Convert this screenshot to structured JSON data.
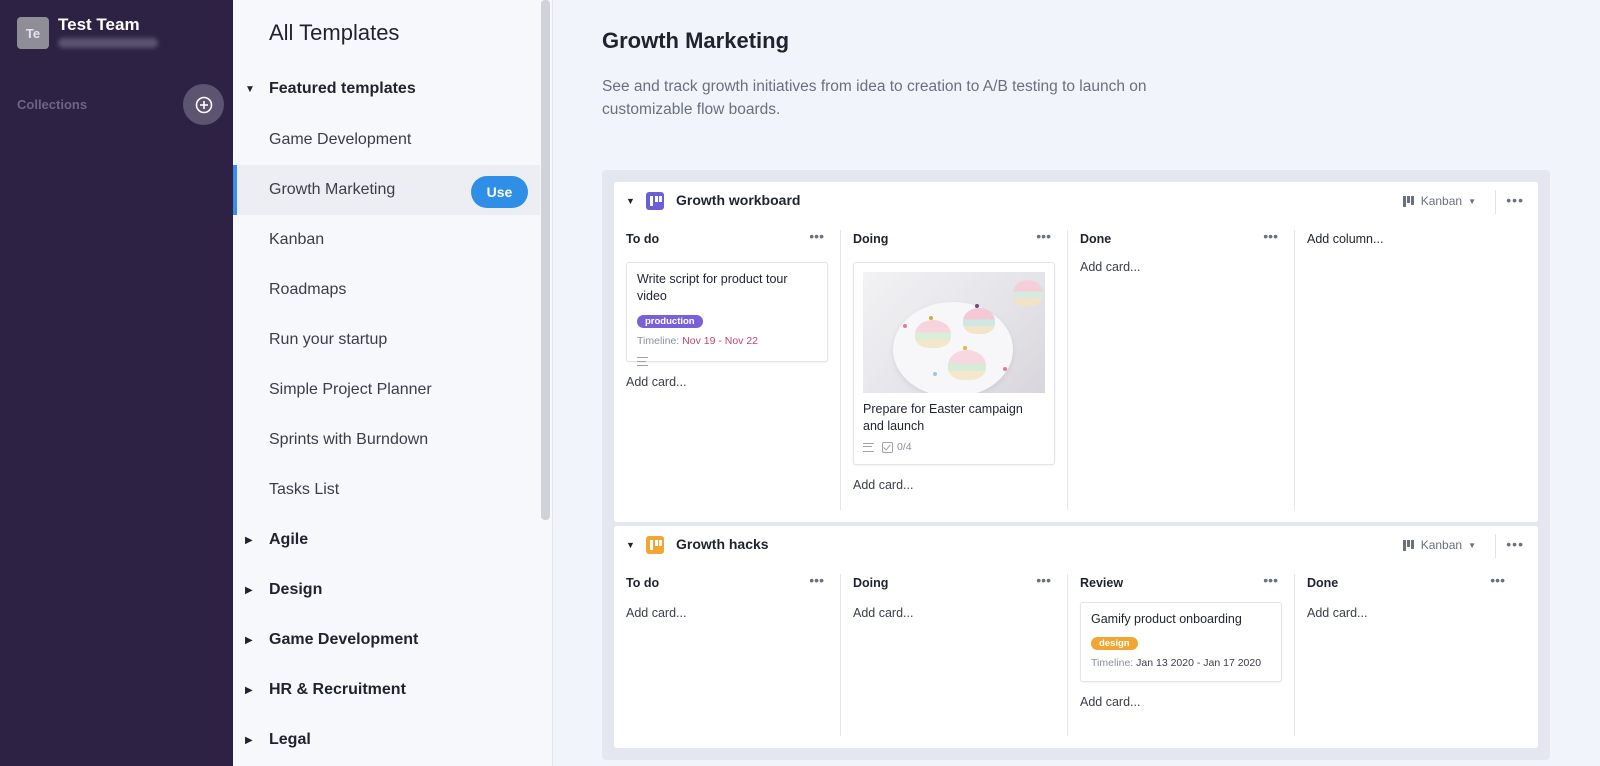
{
  "team": {
    "avatar_initials": "Te",
    "name": "Test Team",
    "collections_label": "Collections"
  },
  "templates_panel": {
    "title": "All Templates",
    "featured_label": "Featured templates",
    "featured_items": [
      "Game Development",
      "Growth Marketing",
      "Kanban",
      "Roadmaps",
      "Run your startup",
      "Simple Project Planner",
      "Sprints with Burndown",
      "Tasks List"
    ],
    "active_item": "Growth Marketing",
    "use_button": "Use",
    "groups": [
      "Agile",
      "Design",
      "Game Development",
      "HR & Recruitment",
      "Legal"
    ]
  },
  "main": {
    "title": "Growth Marketing",
    "description": "See and track growth initiatives from idea to creation to A/B testing to launch on customizable flow boards."
  },
  "boards": [
    {
      "title": "Growth workboard",
      "icon_color": "#6b5fd8",
      "view": "Kanban",
      "columns": [
        {
          "name": "To do",
          "add_card": "Add card...",
          "card": {
            "title": "Write script for product tour video",
            "tag": "production",
            "tag_color": "#7b5fd8",
            "timeline_label": "Timeline:",
            "timeline_value": "Nov 19 - Nov 22"
          }
        },
        {
          "name": "Doing",
          "add_card": "Add card...",
          "card": {
            "title": "Prepare for Easter campaign and launch",
            "checklist": "0/4"
          }
        },
        {
          "name": "Done",
          "add_card": "Add card..."
        }
      ],
      "add_column": "Add column..."
    },
    {
      "title": "Growth hacks",
      "icon_color": "#f2a531",
      "view": "Kanban",
      "columns": [
        {
          "name": "To do",
          "add_card": "Add card..."
        },
        {
          "name": "Doing",
          "add_card": "Add card..."
        },
        {
          "name": "Review",
          "add_card": "Add card...",
          "card": {
            "title": "Gamify product onboarding",
            "tag": "design",
            "tag_color": "#f2a531",
            "timeline_label": "Timeline:",
            "timeline_value": "Jan 13 2020 - Jan 17 2020"
          }
        },
        {
          "name": "Done",
          "add_card": "Add card..."
        }
      ]
    }
  ]
}
